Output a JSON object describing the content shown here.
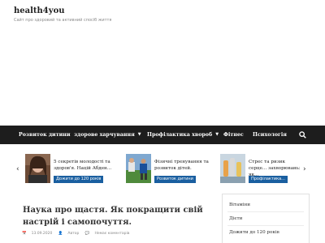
{
  "site": {
    "title": "health4you",
    "tagline": "Сайт про здоровий та активний спосіб життя"
  },
  "nav": {
    "items": [
      {
        "label": "Розвиток дитини",
        "dropdown": false
      },
      {
        "label": "здорове харчування",
        "dropdown": true
      },
      {
        "label": "Профілактика хвороб",
        "dropdown": true
      },
      {
        "label": "Фітнес",
        "dropdown": false
      },
      {
        "label": "Психологія",
        "dropdown": false
      }
    ],
    "search_icon": "search-icon"
  },
  "slider": {
    "prev_icon": "chevron-left-icon",
    "next_icon": "chevron-right-icon",
    "prev_glyph": "‹",
    "next_glyph": "›",
    "slides": [
      {
        "title": "5 секретів молодості та здоров'я. Націй Абден...",
        "category": "Дожити до 120 років"
      },
      {
        "title": "Фізичні тренування та розвиток дітей.",
        "category": "Розвиток дитини"
      },
      {
        "title": "Стрес та ризик серце... захворювань: як...",
        "category": "Профілактика..."
      }
    ]
  },
  "article": {
    "title": "Наука про щастя. Як покращити свій настрій і самопочуття.",
    "date": "13.09.2020",
    "author": "Автор",
    "comments": "Немає коментарів"
  },
  "sidebar": {
    "categories": [
      "Вітаміни",
      "Дієти",
      "Дожити до 120 років"
    ]
  },
  "colors": {
    "navbar": "#1d1d1d",
    "accent": "#1a5fa0"
  }
}
